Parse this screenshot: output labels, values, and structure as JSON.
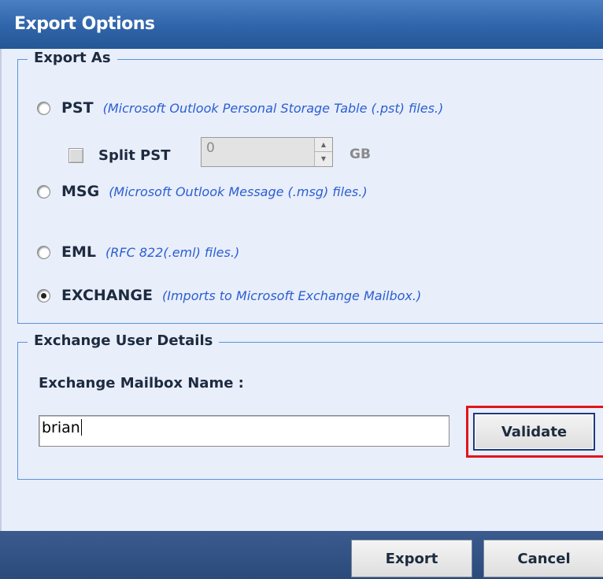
{
  "window": {
    "title": "Export Options"
  },
  "export_as": {
    "legend": "Export As",
    "options": [
      {
        "label": "PST",
        "description": "(Microsoft Outlook Personal Storage Table (.pst) files.)",
        "checked": false
      },
      {
        "label": "MSG",
        "description": "(Microsoft Outlook Message (.msg) files.)",
        "checked": false
      },
      {
        "label": "EML",
        "description": "(RFC 822(.eml) files.)",
        "checked": false
      },
      {
        "label": "EXCHANGE",
        "description": "(Imports to Microsoft Exchange Mailbox.)",
        "checked": true
      }
    ],
    "split_pst": {
      "label": "Split PST",
      "checked": false,
      "value": "0",
      "unit": "GB"
    }
  },
  "exchange": {
    "legend": "Exchange User Details",
    "mailbox_label": "Exchange Mailbox Name :",
    "mailbox_value": "brian",
    "validate_label": "Validate"
  },
  "footer": {
    "export_label": "Export",
    "cancel_label": "Cancel"
  },
  "colors": {
    "title_bar": "#2f64aa",
    "panel_bg": "#e9eefb",
    "group_border": "#5b93d8",
    "description_text": "#2a5fd0",
    "highlight": "#e0161b",
    "footer_bg": "#2b4a7c"
  }
}
